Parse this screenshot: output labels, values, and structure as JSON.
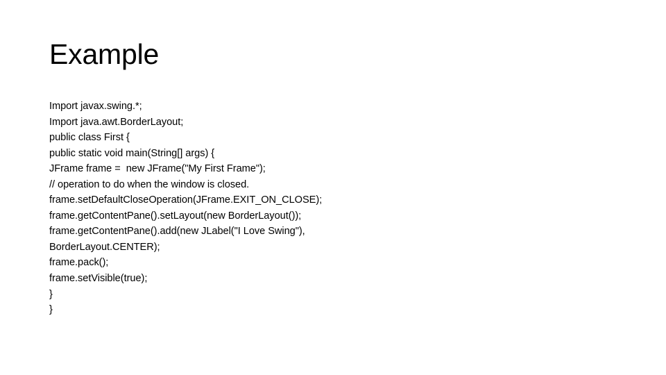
{
  "slide": {
    "title": "Example",
    "background_color": "#FFFFFF",
    "text_color": "#000000",
    "code_lines": [
      {
        "text": "Import javax.swing.*;"
      },
      {
        "text": "Import java.awt.BorderLayout;"
      },
      {
        "text": "public class First {"
      },
      {
        "text": "public static void main(String[] args) {"
      },
      {
        "text": "JFrame frame =  new JFrame(\"My First Frame\");"
      },
      {
        "text": "// operation to do when the window is closed."
      },
      {
        "text": "frame.setDefaultCloseOperation(JFrame.EXIT_ON_CLOSE);"
      },
      {
        "text": "frame.getContentPane().setLayout(new BorderLayout());"
      },
      {
        "text": "frame.getContentPane().add(new JLabel(\"I Love Swing\"),"
      },
      {
        "text": "BorderLayout.CENTER);"
      },
      {
        "text": "frame.pack();"
      },
      {
        "text": "frame.setVisible(true);"
      },
      {
        "text": "}"
      },
      {
        "text": "}"
      }
    ]
  }
}
